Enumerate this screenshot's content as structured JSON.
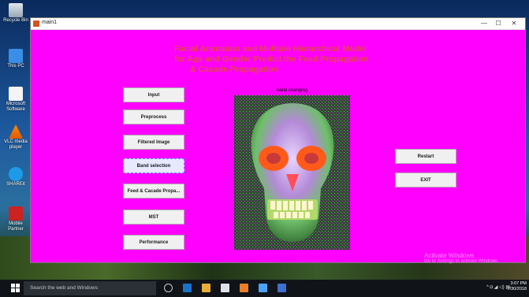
{
  "desktop": {
    "icons": [
      {
        "label": "Recycle Bin"
      },
      {
        "label": "This PC"
      },
      {
        "label": "Microsoft Software"
      },
      {
        "label": "VLC media player"
      },
      {
        "label": "SHAREit"
      },
      {
        "label": "Mobile Partner"
      }
    ],
    "activation": {
      "title": "Activate Windows",
      "subtitle": "Go to Settings to activate Windows."
    }
  },
  "window": {
    "title": "main1",
    "controls": {
      "minimize": "—",
      "maximize": "☐",
      "close": "✕"
    }
  },
  "heading": {
    "line1": "Facial Animation and Multiple Hierarchical Model",
    "line2": "for Age and Gender Predict the Feed Propagation",
    "line3": "& Cacade Propagation"
  },
  "buttons": {
    "input": "Input",
    "preprocess": "Preprocess",
    "filtered": "Filtered Image",
    "band": "Band selection",
    "feed": "Feed & Cacade Propa...",
    "mst": "MST",
    "performance": "Performance",
    "restart": "Restart",
    "exit": "EXIT"
  },
  "image_panel": {
    "caption": "band changing"
  },
  "taskbar": {
    "search_placeholder": "Search the web and Windows",
    "time": "3:07 PM",
    "date": "7/30/2018"
  },
  "colors": {
    "window_bg": "#ff00ff",
    "heading": "#e2474a"
  }
}
